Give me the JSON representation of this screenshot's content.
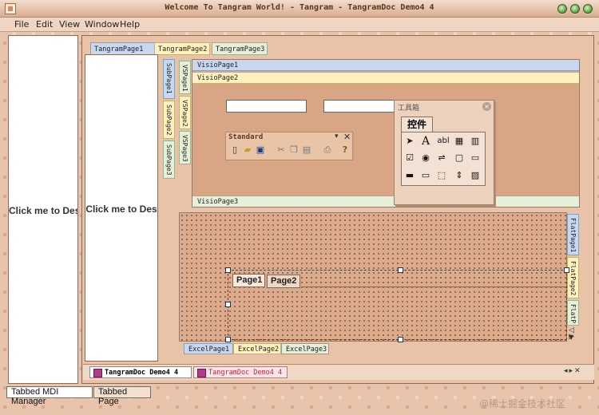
{
  "window": {
    "title": "Welcome To Tangram World! - Tangram - TangramDoc Demo4 4"
  },
  "menu": {
    "items": [
      "File",
      "Edit",
      "View",
      "Window",
      "Help"
    ]
  },
  "left_pane": {
    "text": "Click me to Des"
  },
  "top_tabs": [
    "TangramPage1",
    "TangramPage2",
    "TangramPage3"
  ],
  "inner_pane": {
    "text": "Click me to Des"
  },
  "sub_tabs": [
    "SubPage1",
    "SubPage2",
    "SubPage3"
  ],
  "vs_tabs": [
    "VSPage1",
    "VSPage2",
    "VSPage3"
  ],
  "visio_tabs": [
    "VisioPage1",
    "VisioPage2",
    "VisioPage3"
  ],
  "standard_toolbar": {
    "title": "Standard"
  },
  "toolbox": {
    "title": "工具箱",
    "tab": "控件"
  },
  "flat_tabs": [
    "FlatPage1",
    "FlatPage2",
    "FlatP"
  ],
  "page_tabs": [
    "Page1",
    "Page2"
  ],
  "excel_tabs": [
    "ExcelPage1",
    "ExcelPage2",
    "ExcelPage3"
  ],
  "doc_tabs": [
    "TangramDoc Demo4 4",
    "TangramDoc Demo4 4"
  ],
  "manager_tabs": [
    "Tabbed MDI Manager",
    "Tabbed Page"
  ],
  "watermark": "@稀土掘金技术社区"
}
